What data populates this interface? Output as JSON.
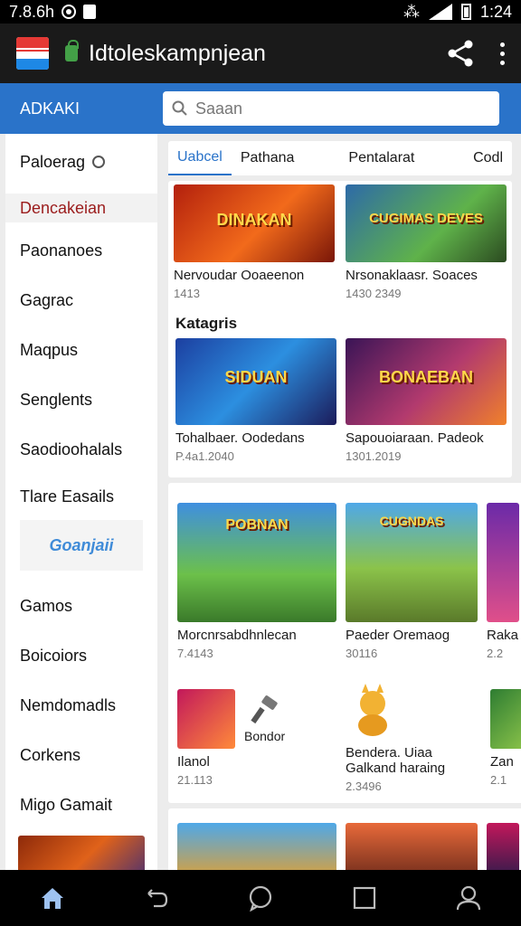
{
  "status": {
    "time_left": "7.8.6h",
    "time_right": "1:24"
  },
  "app": {
    "title": "Idtoleskampnjean"
  },
  "header": {
    "brand": "ADKAKI",
    "search_placeholder": "Saaan"
  },
  "sidebar": {
    "items": [
      "Paloerag",
      "Dencakeian",
      "Paonanoes",
      "Gagrac",
      "Maqpus",
      "Senglents",
      "Saodioohalals",
      "Tlare Easails",
      "Gamos",
      "Boicoiors",
      "Nemdomadls",
      "Corkens",
      "Migo Gamait"
    ],
    "badge": "Goanjaii"
  },
  "tabs": [
    "Uabcel",
    "Pathana",
    "Pentalarat",
    "Codl"
  ],
  "card1": {
    "tiles": [
      {
        "caption": "DINAKAN",
        "name": "Nervoudar Ooaeenon",
        "value": "1413"
      },
      {
        "caption": "CUGIMAS DEVES",
        "name": "Nrsonaklaasr. Soaces",
        "value": "1430 2349"
      }
    ],
    "section_title": "Katagris",
    "tiles2": [
      {
        "caption": "SIDUAN",
        "name": "Tohalbaer. Oodedans",
        "value": "P.4a1.2040"
      },
      {
        "caption": "BONAEBAN",
        "name": "Sapouoiaraan. Padeok",
        "value": "1301.2019"
      }
    ]
  },
  "card2": {
    "tiles": [
      {
        "caption": "POBNAN",
        "name": "Morcnrsabdhnlecan",
        "value": "7.4143"
      },
      {
        "caption": "CUGNDAS",
        "name": "Paeder Oremaog",
        "value": "30116"
      },
      {
        "caption": "",
        "name": "Raka",
        "value": "2.2"
      }
    ],
    "small": [
      {
        "name": "Ilanol",
        "value": "21.113",
        "label": "Bondor"
      },
      {
        "name": "Bendera. Uiaa Galkand haraing",
        "value": "2.3496"
      },
      {
        "name": "Zan",
        "value": "2.1"
      }
    ]
  },
  "nav": [
    "home-icon",
    "back-icon",
    "chat-icon",
    "recents-icon",
    "profile-icon"
  ]
}
